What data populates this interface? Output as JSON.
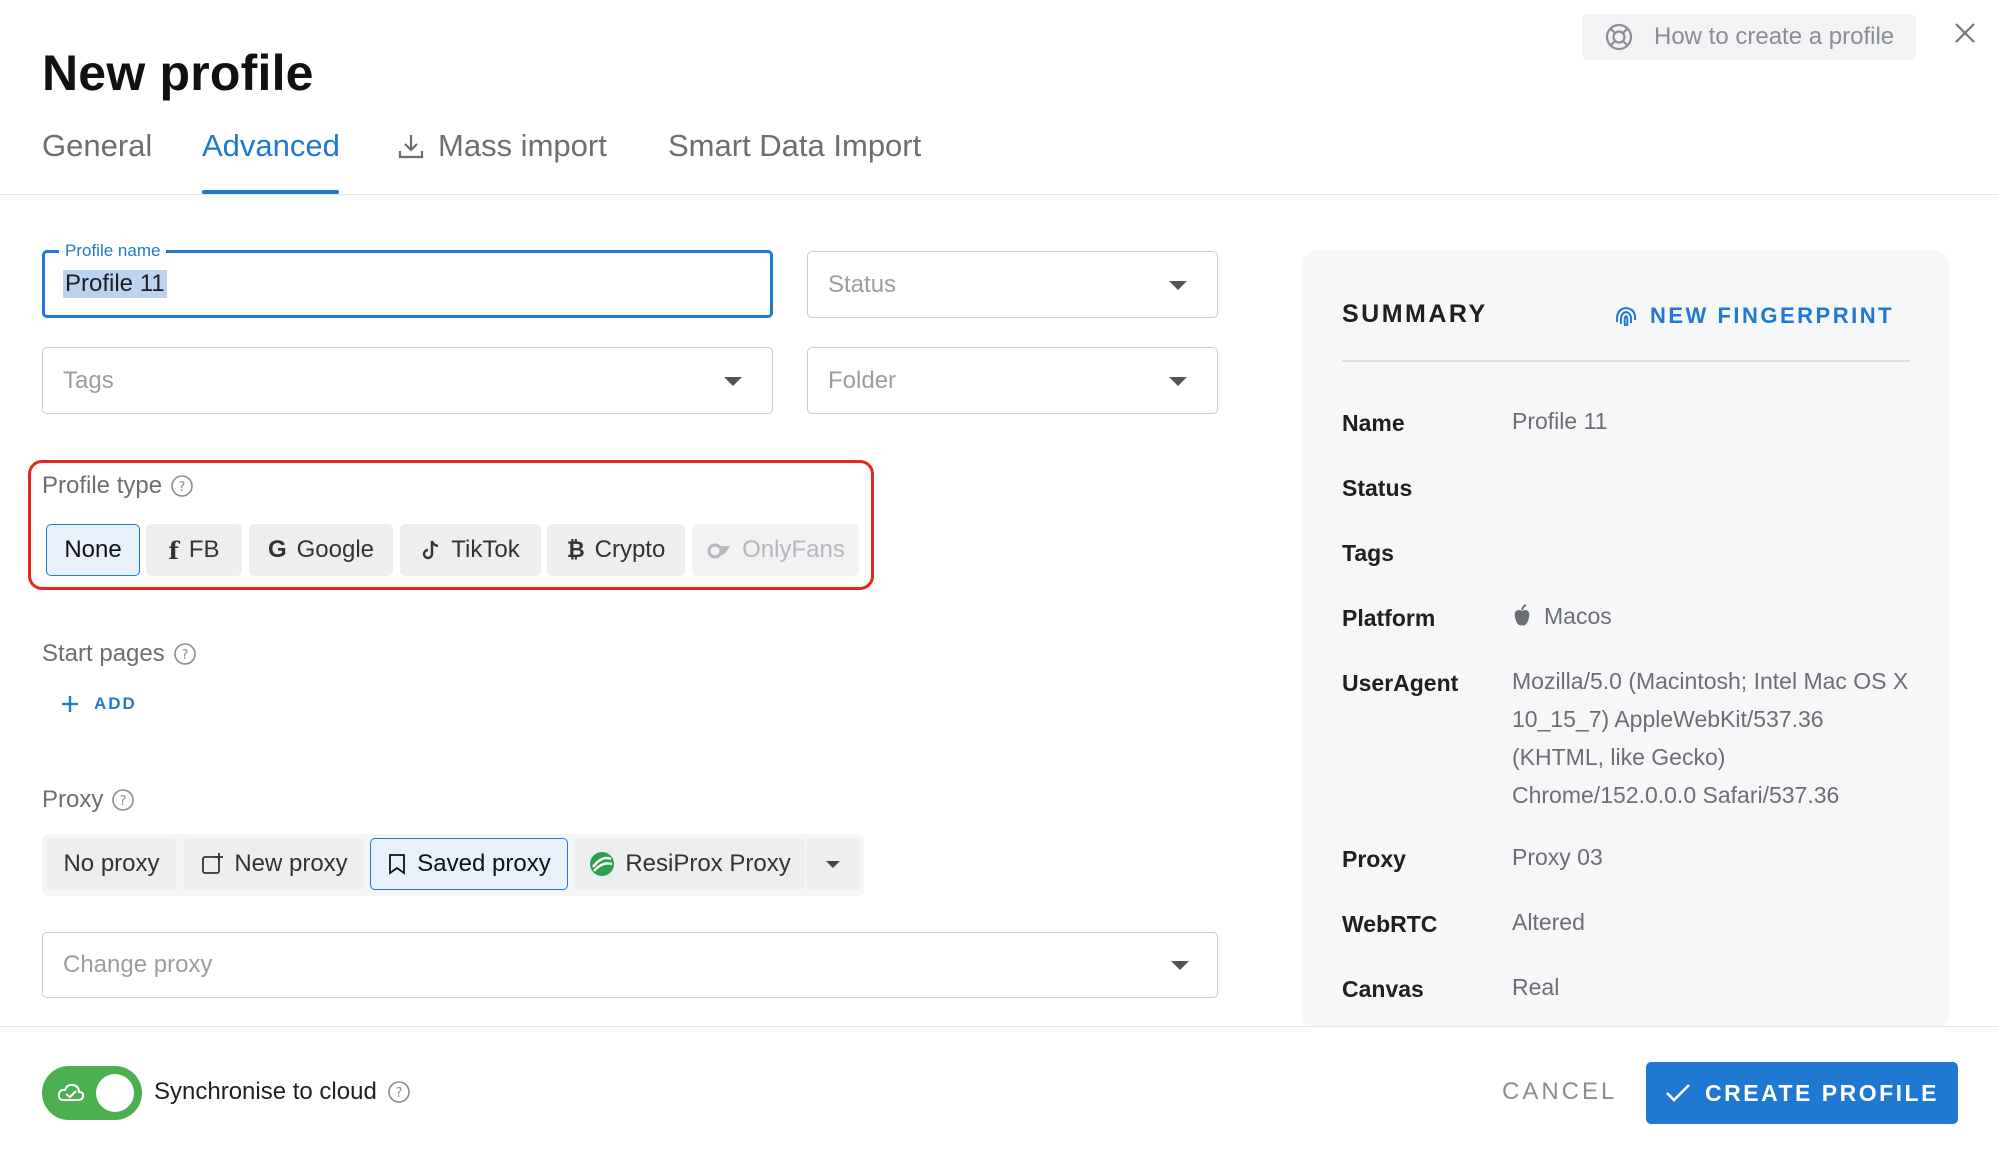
{
  "header": {
    "title": "New profile",
    "help_label": "How to create a profile",
    "help_icon": "lifebuoy-icon",
    "close_icon": "close-icon"
  },
  "tabs": [
    {
      "label": "General",
      "active": false
    },
    {
      "label": "Advanced",
      "active": true
    },
    {
      "label": "Mass import",
      "icon": "download-icon",
      "active": false
    },
    {
      "label": "Smart Data Import",
      "active": false
    }
  ],
  "form": {
    "profile_name": {
      "label": "Profile name",
      "value": "Profile 11"
    },
    "status": {
      "placeholder": "Status"
    },
    "tags": {
      "placeholder": "Tags"
    },
    "folder": {
      "placeholder": "Folder"
    },
    "profile_type": {
      "label": "Profile type",
      "options": [
        {
          "label": "None",
          "icon": "",
          "state": "active"
        },
        {
          "label": "FB",
          "icon": "facebook-icon",
          "state": "normal"
        },
        {
          "label": "Google",
          "icon": "google-icon",
          "state": "normal"
        },
        {
          "label": "TikTok",
          "icon": "tiktok-icon",
          "state": "normal"
        },
        {
          "label": "Crypto",
          "icon": "bitcoin-icon",
          "state": "normal"
        },
        {
          "label": "OnlyFans",
          "icon": "onlyfans-icon",
          "state": "disabled"
        }
      ]
    },
    "start_pages": {
      "label": "Start pages",
      "add_label": "ADD"
    },
    "proxy": {
      "label": "Proxy",
      "options": [
        {
          "label": "No proxy",
          "icon": "",
          "state": "normal"
        },
        {
          "label": "New proxy",
          "icon": "add-window-icon",
          "state": "normal"
        },
        {
          "label": "Saved proxy",
          "icon": "bookmark-icon",
          "state": "active"
        },
        {
          "label": "ResiProx Proxy",
          "icon": "resiprox-logo-icon",
          "state": "normal"
        }
      ],
      "change_placeholder": "Change proxy"
    }
  },
  "summary": {
    "title": "SUMMARY",
    "new_fingerprint_label": "NEW FINGERPRINT",
    "rows": [
      {
        "key": "Name",
        "value": "Profile 11"
      },
      {
        "key": "Status",
        "value": ""
      },
      {
        "key": "Tags",
        "value": ""
      },
      {
        "key": "Platform",
        "value": "Macos"
      },
      {
        "key": "UserAgent",
        "value": "Mozilla/5.0 (Macintosh; Intel Mac OS X 10_15_7) AppleWebKit/537.36 (KHTML, like Gecko) Chrome/152.0.0.0 Safari/537.36"
      },
      {
        "key": "Proxy",
        "value": "Proxy 03"
      },
      {
        "key": "WebRTC",
        "value": "Altered"
      },
      {
        "key": "Canvas",
        "value": "Real"
      }
    ]
  },
  "footer": {
    "sync_label": "Synchronise to cloud",
    "sync_on": true,
    "cancel_label": "CANCEL",
    "create_label": "CREATE PROFILE"
  },
  "colors": {
    "accent": "#1f78d1",
    "toggle_on": "#4caf50",
    "highlight_border": "#e5281d"
  }
}
